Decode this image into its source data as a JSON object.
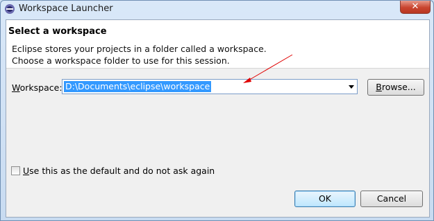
{
  "window": {
    "title": "Workspace Launcher",
    "close_label": "✕"
  },
  "banner": {
    "heading": "Select a workspace",
    "line1": "Eclipse stores your projects in a folder called a workspace.",
    "line2": "Choose a workspace folder to use for this session."
  },
  "workspace": {
    "label_mnemonic": "W",
    "label_rest": "orkspace:",
    "value": "D:\\Documents\\eclipse\\workspace"
  },
  "buttons": {
    "browse_mnemonic": "B",
    "browse_rest": "rowse...",
    "ok": "OK",
    "cancel": "Cancel"
  },
  "default_checkbox": {
    "mnemonic": "U",
    "rest": "se this as the default and do not ask again",
    "checked": false
  },
  "colors": {
    "annotation_arrow": "#e00000",
    "selection": "#3399ff"
  }
}
